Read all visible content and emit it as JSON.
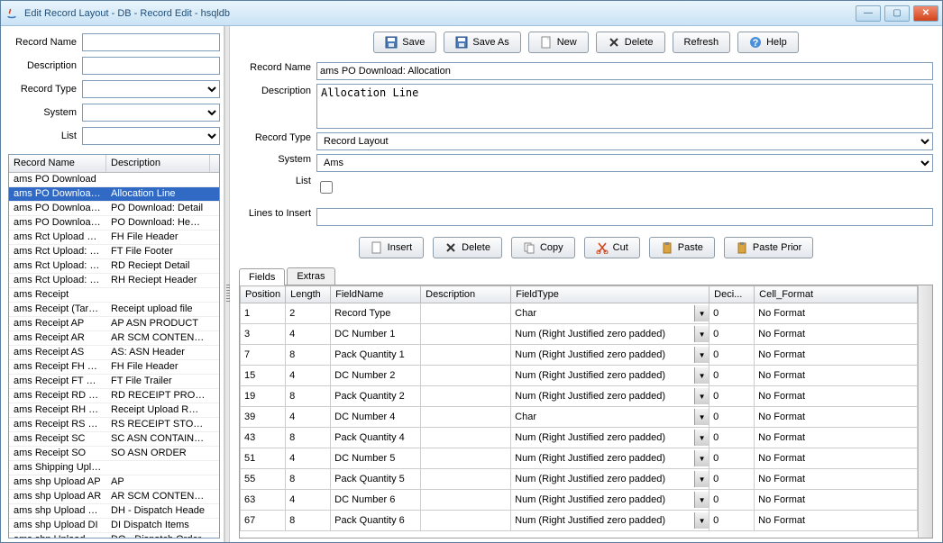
{
  "window": {
    "title": "Edit Record Layout - DB - Record Edit - hsqldb"
  },
  "leftform": {
    "recordname_label": "Record Name",
    "description_label": "Description",
    "recordtype_label": "Record Type",
    "system_label": "System",
    "list_label": "List"
  },
  "recordlist": {
    "col1": "Record Name",
    "col2": "Description",
    "rows": [
      {
        "name": "ams PO Download",
        "desc": ""
      },
      {
        "name": "ams PO Download: …",
        "desc": "Allocation Line",
        "sel": true
      },
      {
        "name": "ams PO Download: …",
        "desc": "PO Download: Detail"
      },
      {
        "name": "ams PO Download: …",
        "desc": "PO Download: Heade"
      },
      {
        "name": "ams Rct Upload FH …",
        "desc": "FH File Header"
      },
      {
        "name": "ams Rct Upload: FT…",
        "desc": "FT File Footer"
      },
      {
        "name": "ams Rct Upload: RD",
        "desc": "RD Reciept Detail"
      },
      {
        "name": "ams Rct Upload: RH",
        "desc": "RH Reciept Header"
      },
      {
        "name": "ams Receipt",
        "desc": ""
      },
      {
        "name": "ams Receipt (Taret …",
        "desc": "Receipt upload file"
      },
      {
        "name": "ams Receipt AP",
        "desc": "AP ASN PRODUCT"
      },
      {
        "name": "ams Receipt AR",
        "desc": "AR SCM CONTENTS O"
      },
      {
        "name": "ams Receipt AS",
        "desc": "AS: ASN Header"
      },
      {
        "name": "ams Receipt FH He…",
        "desc": "FH File Header"
      },
      {
        "name": "ams Receipt FT File …",
        "desc": "FT File Trailer"
      },
      {
        "name": "ams Receipt RD Re…",
        "desc": "RD RECEIPT PRODUC"
      },
      {
        "name": "ams Receipt RH Re…",
        "desc": "Receipt Upload RH R"
      },
      {
        "name": "ams Receipt RS Rec…",
        "desc": "RS RECEIPT STORE A"
      },
      {
        "name": "ams Receipt SC",
        "desc": "SC ASN CONTAINER"
      },
      {
        "name": "ams Receipt SO",
        "desc": "SO ASN ORDER"
      },
      {
        "name": "ams Shipping Upload",
        "desc": ""
      },
      {
        "name": "ams shp Upload AP",
        "desc": "AP"
      },
      {
        "name": "ams shp Upload AR",
        "desc": "AR SCM CONTENTS O"
      },
      {
        "name": "ams shp Upload DH",
        "desc": "DH - Dispatch Heade"
      },
      {
        "name": "ams shp Upload DI",
        "desc": "DI Dispatch Items"
      },
      {
        "name": "ams shp Upload DO",
        "desc": "DO - Dispatch Order"
      }
    ]
  },
  "toolbar": {
    "save": "Save",
    "saveas": "Save As",
    "new": "New",
    "delete": "Delete",
    "refresh": "Refresh",
    "help": "Help"
  },
  "detail": {
    "recordname_label": "Record Name",
    "recordname_value": "ams PO Download: Allocation",
    "description_label": "Description",
    "description_value": "Allocation Line",
    "recordtype_label": "Record Type",
    "recordtype_value": "Record Layout",
    "system_label": "System",
    "system_value": "Ams",
    "list_label": "List",
    "lines_label": "Lines to Insert",
    "lines_value": ""
  },
  "midtoolbar": {
    "insert": "Insert",
    "delete": "Delete",
    "copy": "Copy",
    "cut": "Cut",
    "paste": "Paste",
    "pasteprior": "Paste Prior"
  },
  "tabs": {
    "fields": "Fields",
    "extras": "Extras"
  },
  "grid": {
    "cols": {
      "position": "Position",
      "length": "Length",
      "fieldname": "FieldName",
      "description": "Description",
      "fieldtype": "FieldType",
      "deci": "Deci...",
      "cellformat": "Cell_Format"
    },
    "rows": [
      {
        "pos": "1",
        "len": "2",
        "fname": "Record Type",
        "desc": "",
        "ftype": "Char",
        "deci": "0",
        "fmt": "No Format"
      },
      {
        "pos": "3",
        "len": "4",
        "fname": "DC Number 1",
        "desc": "",
        "ftype": "Num (Right Justified zero padded)",
        "deci": "0",
        "fmt": "No Format"
      },
      {
        "pos": "7",
        "len": "8",
        "fname": "Pack Quantity 1",
        "desc": "",
        "ftype": "Num (Right Justified zero padded)",
        "deci": "0",
        "fmt": "No Format"
      },
      {
        "pos": "15",
        "len": "4",
        "fname": "DC Number 2",
        "desc": "",
        "ftype": "Num (Right Justified zero padded)",
        "deci": "0",
        "fmt": "No Format"
      },
      {
        "pos": "19",
        "len": "8",
        "fname": "Pack Quantity 2",
        "desc": "",
        "ftype": "Num (Right Justified zero padded)",
        "deci": "0",
        "fmt": "No Format"
      },
      {
        "pos": "39",
        "len": "4",
        "fname": "DC Number 4",
        "desc": "",
        "ftype": "Char",
        "deci": "0",
        "fmt": "No Format"
      },
      {
        "pos": "43",
        "len": "8",
        "fname": "Pack Quantity 4",
        "desc": "",
        "ftype": "Num (Right Justified zero padded)",
        "deci": "0",
        "fmt": "No Format"
      },
      {
        "pos": "51",
        "len": "4",
        "fname": "DC Number 5",
        "desc": "",
        "ftype": "Num (Right Justified zero padded)",
        "deci": "0",
        "fmt": "No Format"
      },
      {
        "pos": "55",
        "len": "8",
        "fname": "Pack Quantity 5",
        "desc": "",
        "ftype": "Num (Right Justified zero padded)",
        "deci": "0",
        "fmt": "No Format"
      },
      {
        "pos": "63",
        "len": "4",
        "fname": "DC Number 6",
        "desc": "",
        "ftype": "Num (Right Justified zero padded)",
        "deci": "0",
        "fmt": "No Format"
      },
      {
        "pos": "67",
        "len": "8",
        "fname": "Pack Quantity 6",
        "desc": "",
        "ftype": "Num (Right Justified zero padded)",
        "deci": "0",
        "fmt": "No Format"
      }
    ]
  }
}
